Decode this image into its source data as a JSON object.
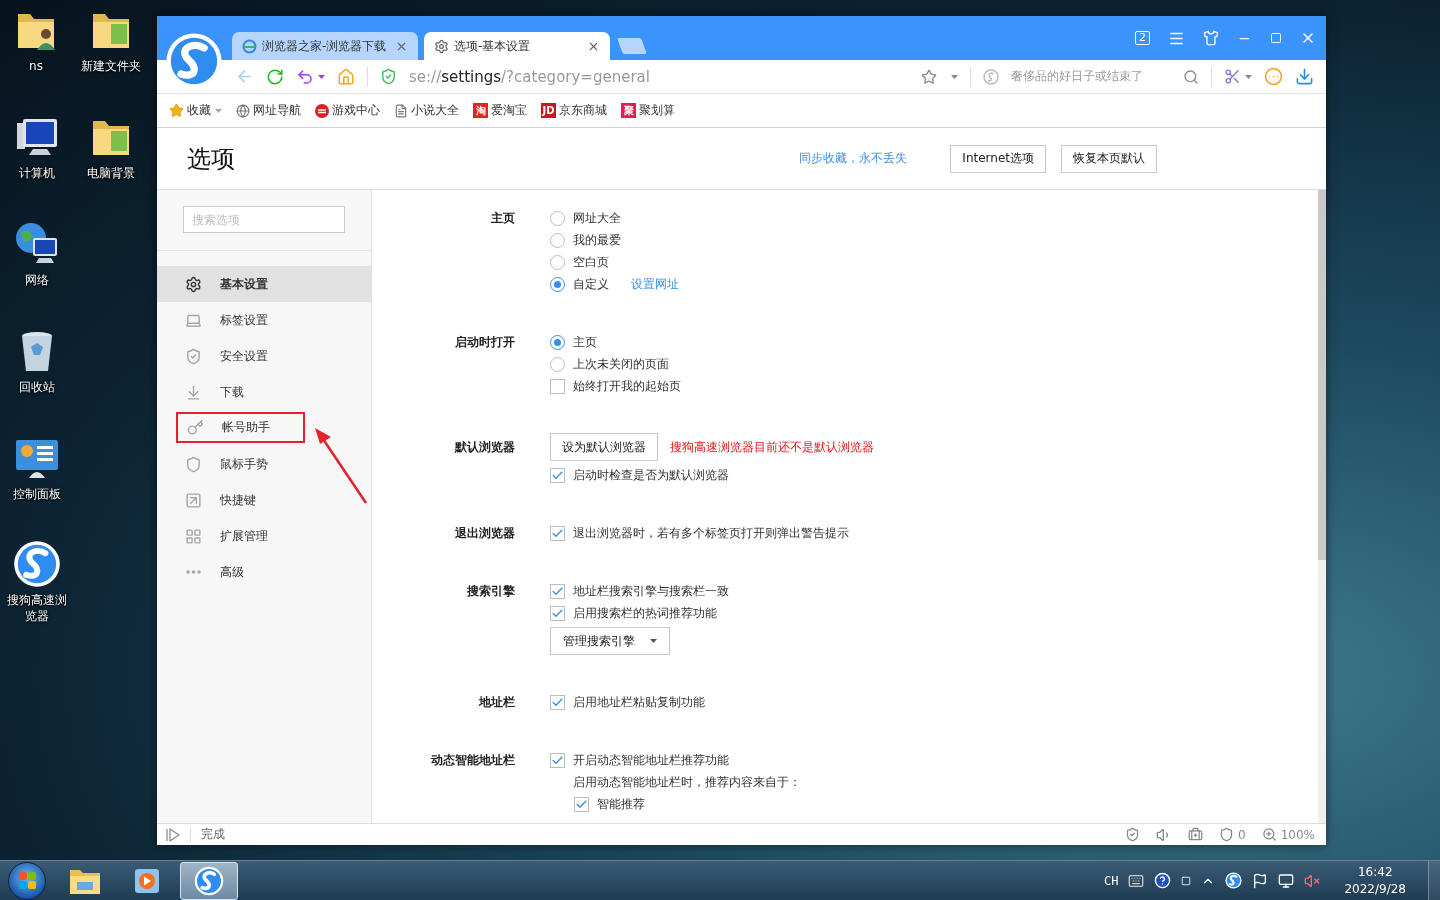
{
  "desktop_icons": [
    {
      "label": "ns",
      "kind": "user-folder"
    },
    {
      "label": "新建文件夹",
      "kind": "folder"
    },
    {
      "label": "计算机",
      "kind": "computer"
    },
    {
      "label": "电脑背景",
      "kind": "folder"
    },
    {
      "label": "网络",
      "kind": "network"
    },
    {
      "label": "回收站",
      "kind": "recycle"
    },
    {
      "label": "控制面板",
      "kind": "control"
    },
    {
      "label": "搜狗高速浏览器",
      "kind": "sogou"
    }
  ],
  "browser": {
    "tabs": [
      {
        "title": "浏览器之家-浏览器下载",
        "kind": "web",
        "selected": false
      },
      {
        "title": "选项-基本设置",
        "kind": "settings",
        "selected": true
      }
    ],
    "window_count": "2",
    "address": {
      "scheme": "se://",
      "host": "settings",
      "path": "/?category=general"
    },
    "search_placeholder": "奢侈品的好日子或结束了",
    "bookmarks": [
      {
        "label": "收藏",
        "kind": "star"
      },
      {
        "label": "网址导航",
        "kind": "globe"
      },
      {
        "label": "游戏中心",
        "kind": "game"
      },
      {
        "label": "小说大全",
        "kind": "doc"
      },
      {
        "label": "爱淘宝",
        "kind": "badge",
        "badge": "淘",
        "color": "#e8231c"
      },
      {
        "label": "京东商城",
        "kind": "badge",
        "badge": "JD",
        "color": "#c81623"
      },
      {
        "label": "聚划算",
        "kind": "badge",
        "badge": "聚",
        "color": "#e51c4e"
      }
    ],
    "page_title": "选项",
    "sync_link": "同步收藏，永不丢失",
    "header_buttons": [
      "Internet选项",
      "恢复本页默认"
    ],
    "sidebar_search_placeholder": "搜索选项",
    "sidebar": [
      {
        "label": "基本设置",
        "kind": "gear",
        "selected": true,
        "highlighted": false
      },
      {
        "label": "标签设置",
        "kind": "tab",
        "selected": false,
        "highlighted": false
      },
      {
        "label": "安全设置",
        "kind": "shield",
        "selected": false,
        "highlighted": false
      },
      {
        "label": "下载",
        "kind": "download",
        "selected": false,
        "highlighted": false
      },
      {
        "label": "帐号助手",
        "kind": "key",
        "selected": false,
        "highlighted": true
      },
      {
        "label": "鼠标手势",
        "kind": "mouse",
        "selected": false,
        "highlighted": false
      },
      {
        "label": "快捷键",
        "kind": "shortcut",
        "selected": false,
        "highlighted": false
      },
      {
        "label": "扩展管理",
        "kind": "grid",
        "selected": false,
        "highlighted": false
      },
      {
        "label": "高级",
        "kind": "more",
        "selected": false,
        "highlighted": false
      }
    ],
    "sections": [
      {
        "label": "主页",
        "items": [
          {
            "kind": "radio",
            "label": "网址大全",
            "selected": false
          },
          {
            "kind": "radio",
            "label": "我的最爱",
            "selected": false
          },
          {
            "kind": "radio",
            "label": "空白页",
            "selected": false
          },
          {
            "kind": "radio",
            "label": "自定义",
            "selected": true,
            "link": "设置网址"
          }
        ]
      },
      {
        "label": "启动时打开",
        "items": [
          {
            "kind": "radio",
            "label": "主页",
            "selected": true
          },
          {
            "kind": "radio",
            "label": "上次未关闭的页面",
            "selected": false
          },
          {
            "kind": "checkbox",
            "label": "始终打开我的起始页",
            "checked": false
          }
        ]
      },
      {
        "label": "默认浏览器",
        "items": [
          {
            "kind": "button",
            "label": "设为默认浏览器",
            "note": "搜狗高速浏览器目前还不是默认浏览器"
          },
          {
            "kind": "checkbox",
            "label": "启动时检查是否为默认浏览器",
            "checked": true
          }
        ]
      },
      {
        "label": "退出浏览器",
        "items": [
          {
            "kind": "checkbox",
            "label": "退出浏览器时，若有多个标签页打开则弹出警告提示",
            "checked": true
          }
        ]
      },
      {
        "label": "搜索引擎",
        "items": [
          {
            "kind": "checkbox",
            "label": "地址栏搜索引擎与搜索栏一致",
            "checked": true
          },
          {
            "kind": "checkbox",
            "label": "启用搜索栏的热词推荐功能",
            "checked": true
          },
          {
            "kind": "dropdown",
            "label": "管理搜索引擎"
          }
        ]
      },
      {
        "label": "地址栏",
        "items": [
          {
            "kind": "checkbox",
            "label": "启用地址栏粘贴复制功能",
            "checked": true
          }
        ]
      },
      {
        "label": "动态智能地址栏",
        "items": [
          {
            "kind": "checkbox",
            "label": "开启动态智能地址栏推荐功能",
            "checked": true
          },
          {
            "kind": "text",
            "label": "启用动态智能地址栏时，推荐内容来自于："
          },
          {
            "kind": "subcheckbox",
            "label": "智能推荐",
            "checked": true
          }
        ]
      }
    ],
    "status": {
      "text": "完成",
      "ad_count": "0",
      "zoom": "100%"
    }
  },
  "taskbar": {
    "apps": [
      {
        "kind": "explorer",
        "active": false
      },
      {
        "kind": "media",
        "active": false
      },
      {
        "kind": "sogou",
        "active": true
      }
    ],
    "language": "CH",
    "time": "16:42",
    "date": "2022/9/28"
  }
}
